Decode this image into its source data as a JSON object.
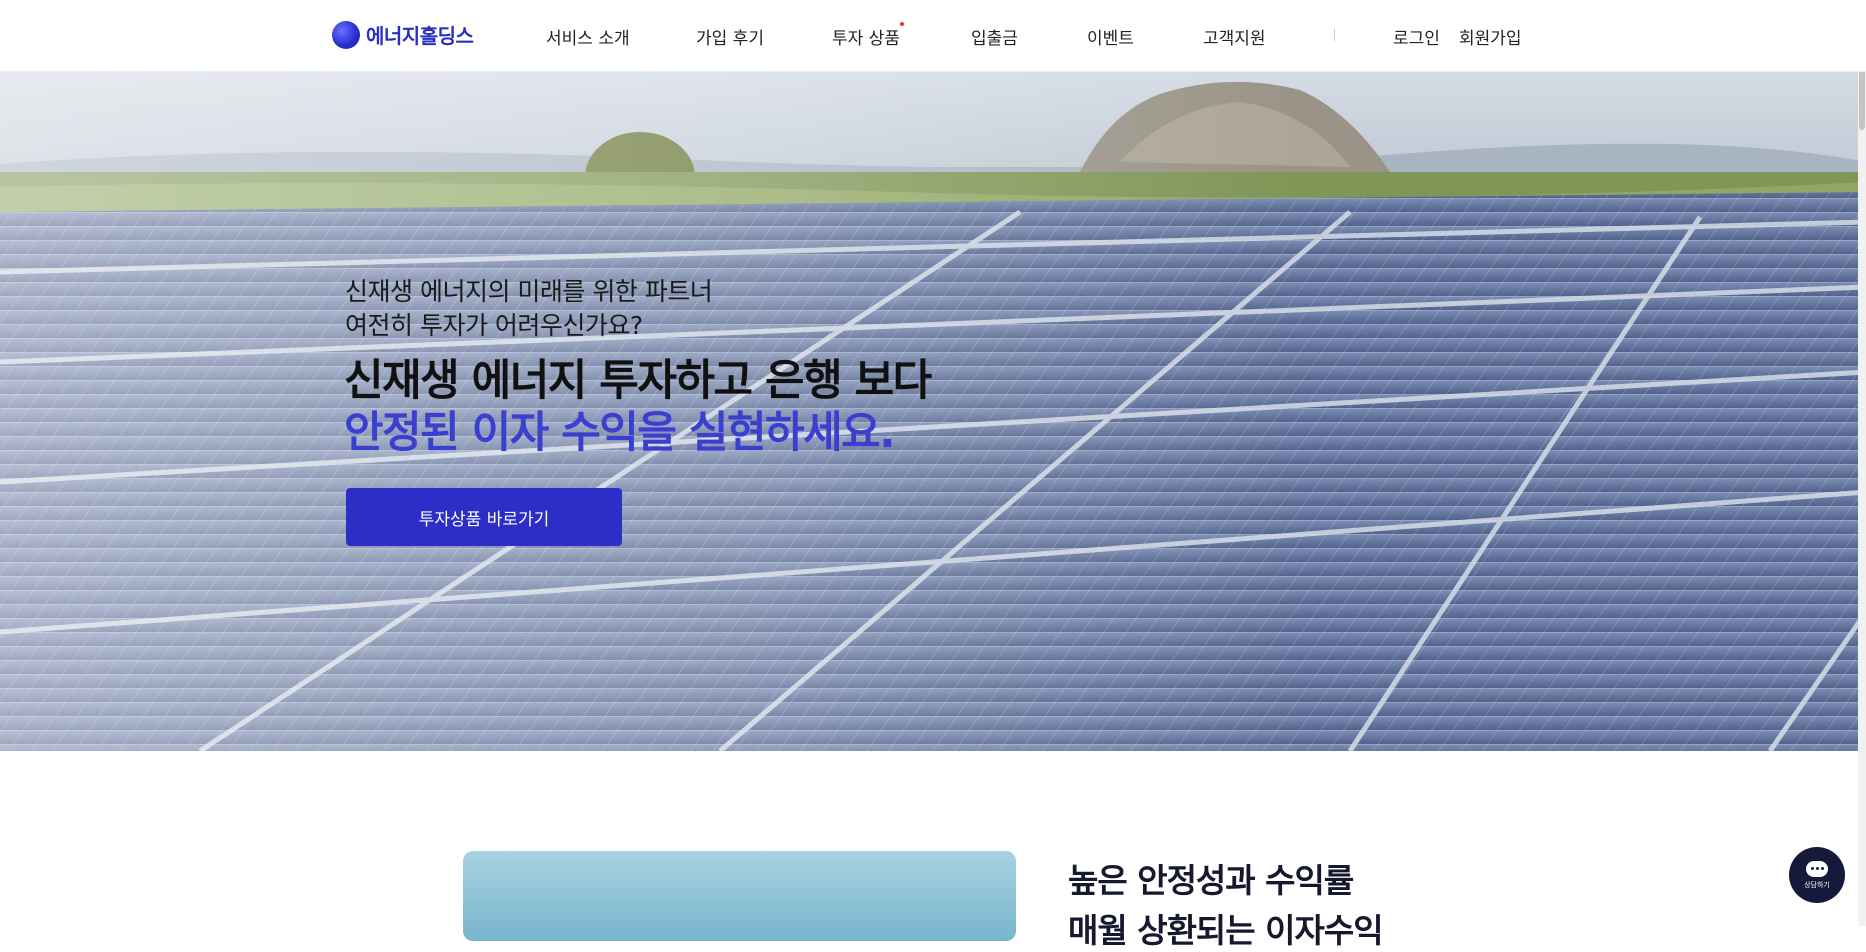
{
  "brand": {
    "name": "에너지홀딩스",
    "accent": "#2b2fc7"
  },
  "nav": {
    "items": [
      {
        "label": "서비스 소개"
      },
      {
        "label": "가입 후기"
      },
      {
        "label": "투자 상품",
        "dot": true
      },
      {
        "label": "입출금"
      },
      {
        "label": "이벤트"
      },
      {
        "label": "고객지원"
      }
    ],
    "login": "로그인",
    "signup": "회원가입"
  },
  "hero": {
    "sub_line1": "신재생 에너지의 미래를 위한 파트너",
    "sub_line2": "여전히 투자가 어려우신가요?",
    "title_line1": "신재생 에너지 투자하고 은행 보다",
    "title_line2": "안정된 이자 수익을 실현하세요.",
    "cta": "투자상품 바로가기",
    "title_color": "#111111",
    "highlight_color": "#3a3fcf"
  },
  "section": {
    "title_line1": "높은 안정성과 수익률",
    "title_line2": "매월 상환되는 이자수익"
  },
  "chat": {
    "label": "상담하기",
    "icon": "chat-bubble-icon"
  }
}
